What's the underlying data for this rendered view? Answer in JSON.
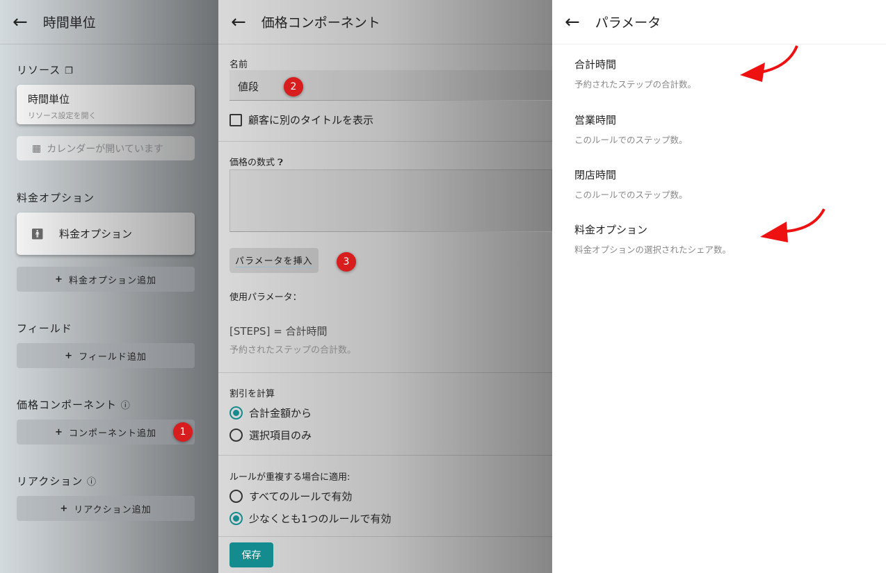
{
  "left": {
    "title": "時間単位",
    "resources_label": "リソース",
    "resource_card": {
      "title": "時間単位",
      "subtitle": "リソース設定を開く"
    },
    "calendar_button": "カレンダーが開いています",
    "pricing_options_label": "料金オプション",
    "pricing_option_card": "料金オプション",
    "add_pricing_option": "料金オプション追加",
    "fields_label": "フィールド",
    "add_field": "フィールド追加",
    "price_components_label": "価格コンポーネント",
    "add_component": "コンポーネント追加",
    "reactions_label": "リアクション",
    "add_reaction": "リアクション追加",
    "badge1": "1"
  },
  "mid": {
    "title": "価格コンポーネント",
    "name_label": "名前",
    "name_value": "値段",
    "badge2": "2",
    "alt_title_checkbox": "顧客に別のタイトルを表示",
    "formula_label": "価格の数式",
    "insert_param_button": "パラメータを挿入",
    "badge3": "3",
    "used_params_label": "使用パラメータ：",
    "used_param_token": "[STEPS]",
    "used_param_eq": " = 合計時間",
    "used_param_desc": "予約されたステップの合計数。",
    "discount_label": "割引を計算",
    "discount_options": [
      "合計金額から",
      "選択項目のみ"
    ],
    "overlap_label": "ルールが重複する場合に適用:",
    "overlap_options": [
      "すべてのルールで有効",
      "少なくとも1つのルールで有効"
    ],
    "save": "保存"
  },
  "right": {
    "title": "パラメータ",
    "params": [
      {
        "title": "合計時間",
        "desc": "予約されたステップの合計数。"
      },
      {
        "title": "営業時間",
        "desc": "このルールでのステップ数。"
      },
      {
        "title": "閉店時間",
        "desc": "このルールでのステップ数。"
      },
      {
        "title": "料金オプション",
        "desc": "料金オプションの選択されたシェア数。"
      }
    ]
  },
  "colors": {
    "accent": "#138b8f",
    "badge": "#d71d1d",
    "arrow": "#ee1111"
  }
}
